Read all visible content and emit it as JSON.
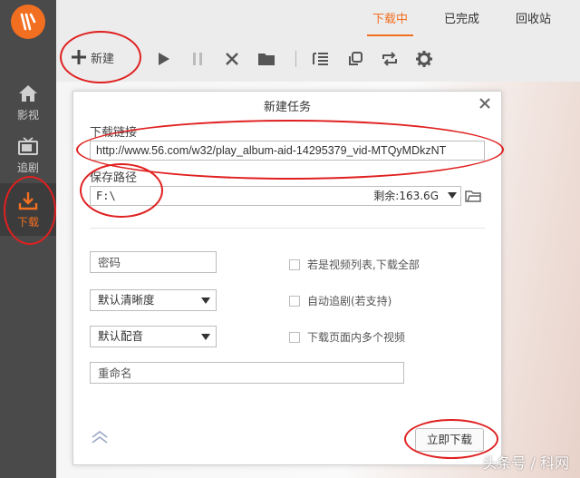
{
  "sidebar": {
    "items": [
      {
        "label": "影视",
        "icon": "home-icon"
      },
      {
        "label": "追剧",
        "icon": "tv-icon"
      },
      {
        "label": "下载",
        "icon": "download-icon"
      }
    ]
  },
  "tabs": [
    {
      "label": "下载中",
      "active": true
    },
    {
      "label": "已完成",
      "active": false
    },
    {
      "label": "回收站",
      "active": false
    }
  ],
  "toolbar": {
    "new_label": "新建",
    "icons": [
      "play-icon",
      "pause-icon",
      "delete-icon",
      "folder-icon",
      "list-icon",
      "copy-icon",
      "repeat-icon",
      "settings-icon"
    ]
  },
  "dialog": {
    "title": "新建任务",
    "link_label": "下载链接",
    "link_value": "http://www.56.com/w32/play_album-aid-14295379_vid-MTQyMDkzNT",
    "save_label": "保存路径",
    "save_path": "F:\\",
    "free_space": "剩余:163.6G",
    "password_placeholder": "密码",
    "quality_select": "默认清晰度",
    "audio_select": "默认配音",
    "rename_placeholder": "重命名",
    "checks": [
      "若是视频列表,下载全部",
      "自动追剧(若支持)",
      "下载页面内多个视频"
    ],
    "download_button": "立即下载"
  },
  "watermark": "头条号 / 科网",
  "colors": {
    "accent": "#f26f21",
    "sidebar_bg": "#4a4a4a",
    "annotation": "#e02020"
  }
}
